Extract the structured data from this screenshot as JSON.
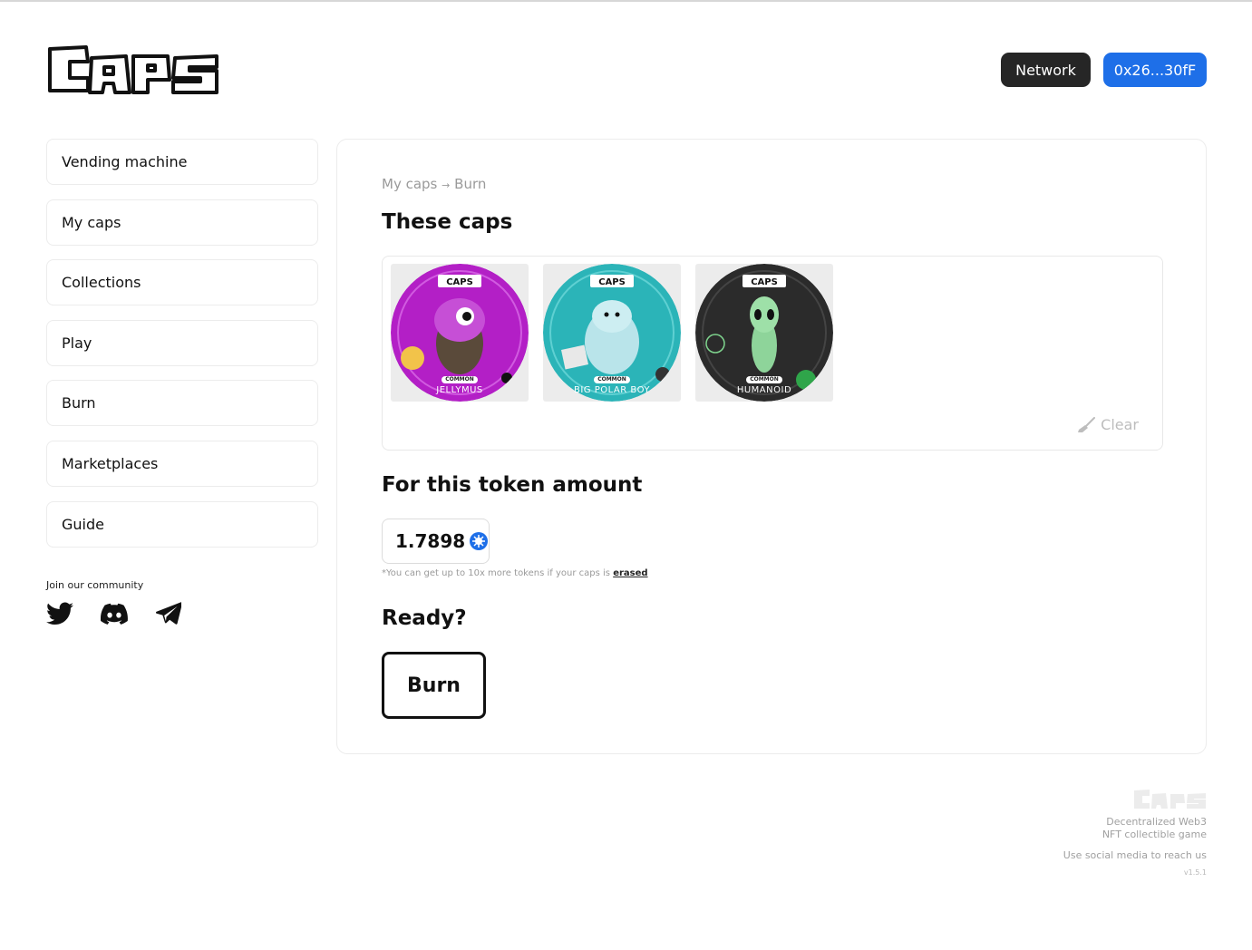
{
  "brand": {
    "logo_text": "CAPS"
  },
  "header": {
    "network_label": "Network",
    "wallet_label": "0x26...30fF"
  },
  "sidebar": {
    "items": [
      {
        "label": "Vending machine"
      },
      {
        "label": "My caps"
      },
      {
        "label": "Collections"
      },
      {
        "label": "Play"
      },
      {
        "label": "Burn"
      },
      {
        "label": "Marketplaces"
      },
      {
        "label": "Guide"
      }
    ],
    "community_label": "Join our community",
    "socials": [
      "twitter-icon",
      "discord-icon",
      "telegram-icon"
    ]
  },
  "main": {
    "breadcrumb": {
      "parent": "My caps",
      "separator": "→",
      "current": "Burn"
    },
    "caps_title": "These caps",
    "caps": [
      {
        "name": "JELLYMUS",
        "rarity": "COMMON",
        "logo": "CAPS MONSTERS",
        "color": "#b31fc6"
      },
      {
        "name": "BIG POLAR BOY",
        "rarity": "COMMON",
        "logo": "CAPS MONSTERS",
        "color": "#2bb4b8"
      },
      {
        "name": "HUMANOID",
        "rarity": "COMMON",
        "logo": "CAPS MONSTERS",
        "color": "#2b2b2b"
      }
    ],
    "clear_label": "Clear",
    "token_title": "For this token amount",
    "token_amount": "1.7898",
    "note_text": "*You can get up to 10x more tokens if your caps is",
    "note_link": "erased",
    "ready_title": "Ready?",
    "burn_label": "Burn"
  },
  "footer": {
    "logo_text": "CAPS",
    "tagline_1": "Decentralized Web3",
    "tagline_2": "NFT collectible game",
    "contact": "Use social media to reach us",
    "version": "v1.5.1"
  },
  "colors": {
    "accent": "#1e6fe8",
    "dark": "#262626"
  }
}
